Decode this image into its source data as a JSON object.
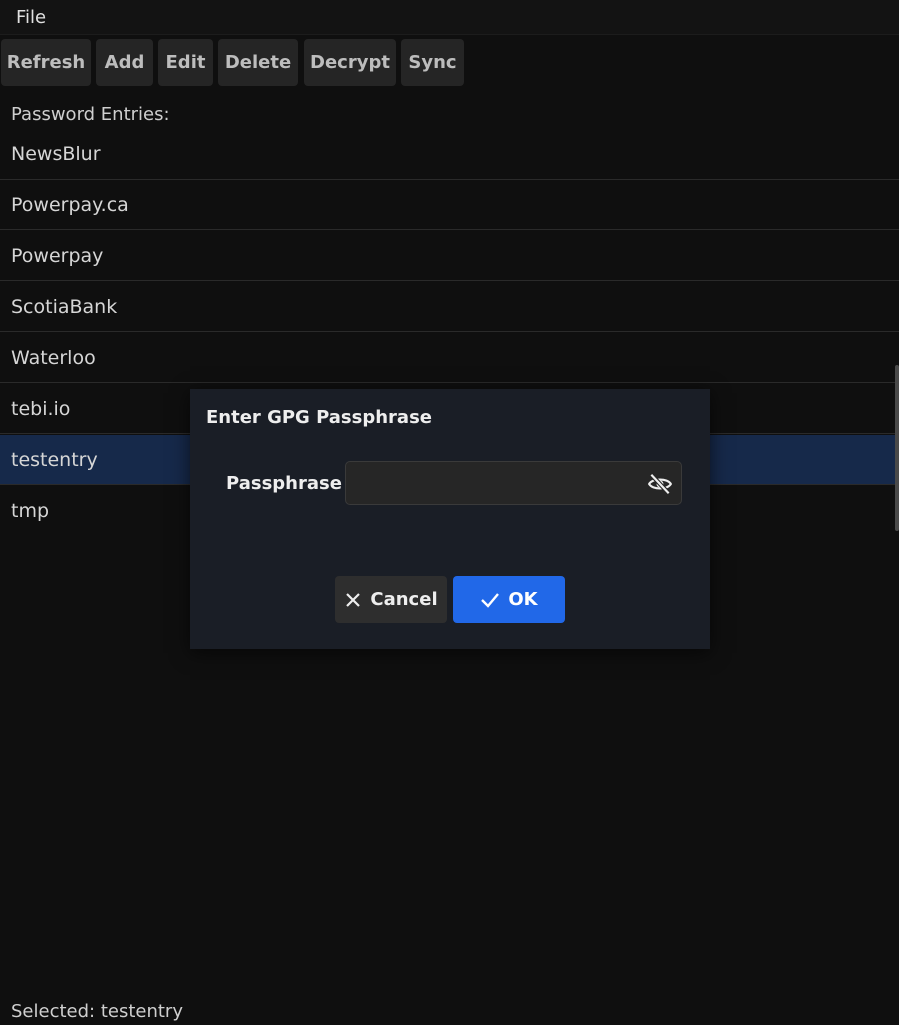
{
  "menu": {
    "file": "File"
  },
  "toolbar": {
    "refresh": "Refresh",
    "add": "Add",
    "edit": "Edit",
    "delete": "Delete",
    "decrypt": "Decrypt",
    "sync": "Sync"
  },
  "list": {
    "label": "Password Entries:",
    "items": [
      "NewsBlur",
      "Powerpay.ca",
      "Powerpay",
      "ScotiaBank",
      "Waterloo",
      "tebi.io",
      "testentry",
      "tmp"
    ],
    "selected": "testentry"
  },
  "status": {
    "text": "Selected: testentry"
  },
  "dialog": {
    "title": "Enter GPG Passphrase",
    "field_label": "Passphrase",
    "field_value": "",
    "toggle_icon": "eye-slash-icon",
    "cancel_label": "Cancel",
    "cancel_icon": "close-icon",
    "ok_label": "OK",
    "ok_icon": "check-icon"
  },
  "colors": {
    "background": "#0f0f0f",
    "selected_row": "#16294a",
    "dialog_bg": "#1a1e26",
    "ok_button": "#2168e8",
    "cancel_button": "#2e2e2e"
  }
}
